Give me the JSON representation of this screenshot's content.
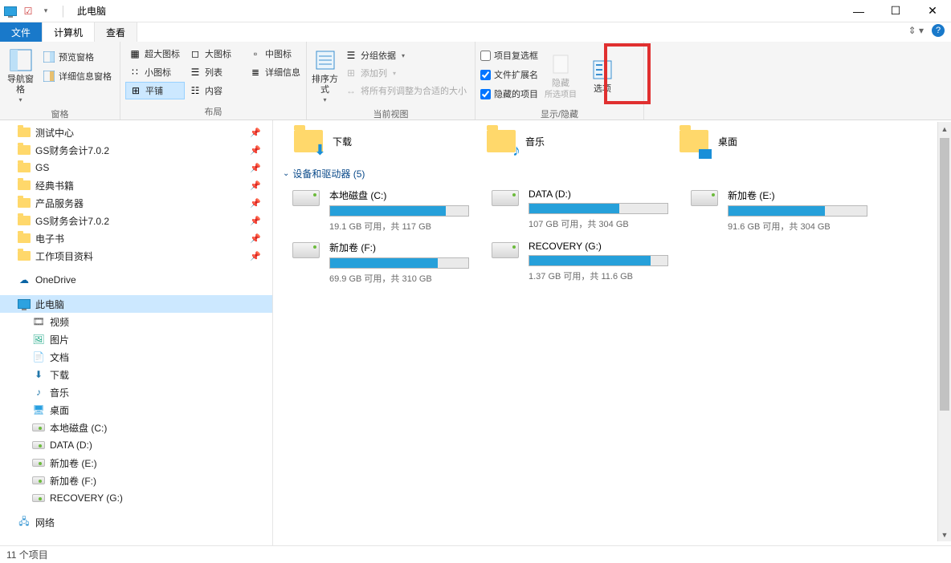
{
  "window": {
    "title": "此电脑"
  },
  "tabs": {
    "file": "文件",
    "computer": "计算机",
    "view": "查看"
  },
  "ribbon": {
    "panes": {
      "nav_pane": "导航窗格",
      "preview": "预览窗格",
      "details": "详细信息窗格",
      "group_label": "窗格"
    },
    "layout": {
      "extra_large": "超大图标",
      "large": "大图标",
      "medium": "中图标",
      "small": "小图标",
      "list": "列表",
      "details": "详细信息",
      "tiles": "平铺",
      "content": "内容",
      "group_label": "布局"
    },
    "current_view": {
      "sort": "排序方式",
      "group_by": "分组依据",
      "add_columns": "添加列",
      "fit_columns": "将所有列调整为合适的大小",
      "group_label": "当前视图"
    },
    "show_hide": {
      "item_checkboxes": "项目复选框",
      "file_ext": "文件扩展名",
      "hidden_items": "隐藏的项目",
      "hide": "隐藏",
      "hide_sub": "所选项目",
      "options": "选项",
      "group_label": "显示/隐藏"
    }
  },
  "nav": {
    "quick_items": [
      "测试中心",
      "GS财务会计7.0.2",
      "GS",
      "经典书籍",
      "产品服务器",
      "GS财务会计7.0.2",
      "电子书",
      "工作项目资料"
    ],
    "onedrive": "OneDrive",
    "this_pc": "此电脑",
    "this_pc_children": [
      "视频",
      "图片",
      "文档",
      "下载",
      "音乐",
      "桌面",
      "本地磁盘 (C:)",
      "DATA (D:)",
      "新加卷 (E:)",
      "新加卷 (F:)",
      "RECOVERY (G:)"
    ],
    "network": "网络"
  },
  "content": {
    "folders": [
      {
        "name": "下载"
      },
      {
        "name": "音乐"
      },
      {
        "name": "桌面"
      }
    ],
    "section": "设备和驱动器 (5)",
    "drives": [
      {
        "name": "本地磁盘 (C:)",
        "info": "19.1 GB 可用，共 117 GB",
        "fill": 84
      },
      {
        "name": "DATA (D:)",
        "info": "107 GB 可用，共 304 GB",
        "fill": 65
      },
      {
        "name": "新加卷 (E:)",
        "info": "91.6 GB 可用，共 304 GB",
        "fill": 70
      },
      {
        "name": "新加卷 (F:)",
        "info": "69.9 GB 可用，共 310 GB",
        "fill": 78
      },
      {
        "name": "RECOVERY (G:)",
        "info": "1.37 GB 可用，共 11.6 GB",
        "fill": 88
      }
    ]
  },
  "status": {
    "count": "11 个项目"
  }
}
